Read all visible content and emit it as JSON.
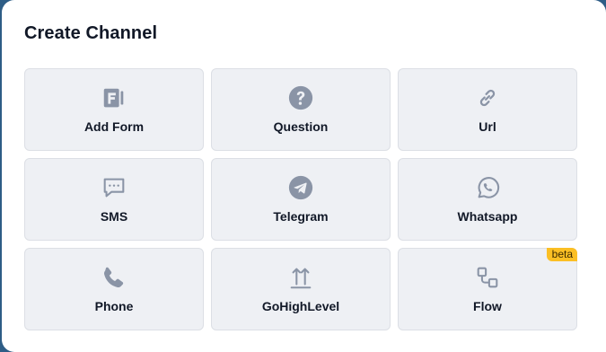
{
  "dialog": {
    "title": "Create Channel"
  },
  "channels": [
    {
      "label": "Add Form",
      "icon": "form-icon"
    },
    {
      "label": "Question",
      "icon": "question-icon"
    },
    {
      "label": "Url",
      "icon": "link-icon"
    },
    {
      "label": "SMS",
      "icon": "chat-dots-icon"
    },
    {
      "label": "Telegram",
      "icon": "telegram-icon"
    },
    {
      "label": "Whatsapp",
      "icon": "whatsapp-icon"
    },
    {
      "label": "Phone",
      "icon": "phone-icon"
    },
    {
      "label": "GoHighLevel",
      "icon": "gohighlevel-icon"
    },
    {
      "label": "Flow",
      "icon": "flow-icon",
      "badge": "beta"
    }
  ],
  "colors": {
    "icon": "#8a94a6",
    "card_bg": "#eef0f4",
    "badge_bg": "#fbbf24",
    "backdrop": "#2e5d86"
  }
}
